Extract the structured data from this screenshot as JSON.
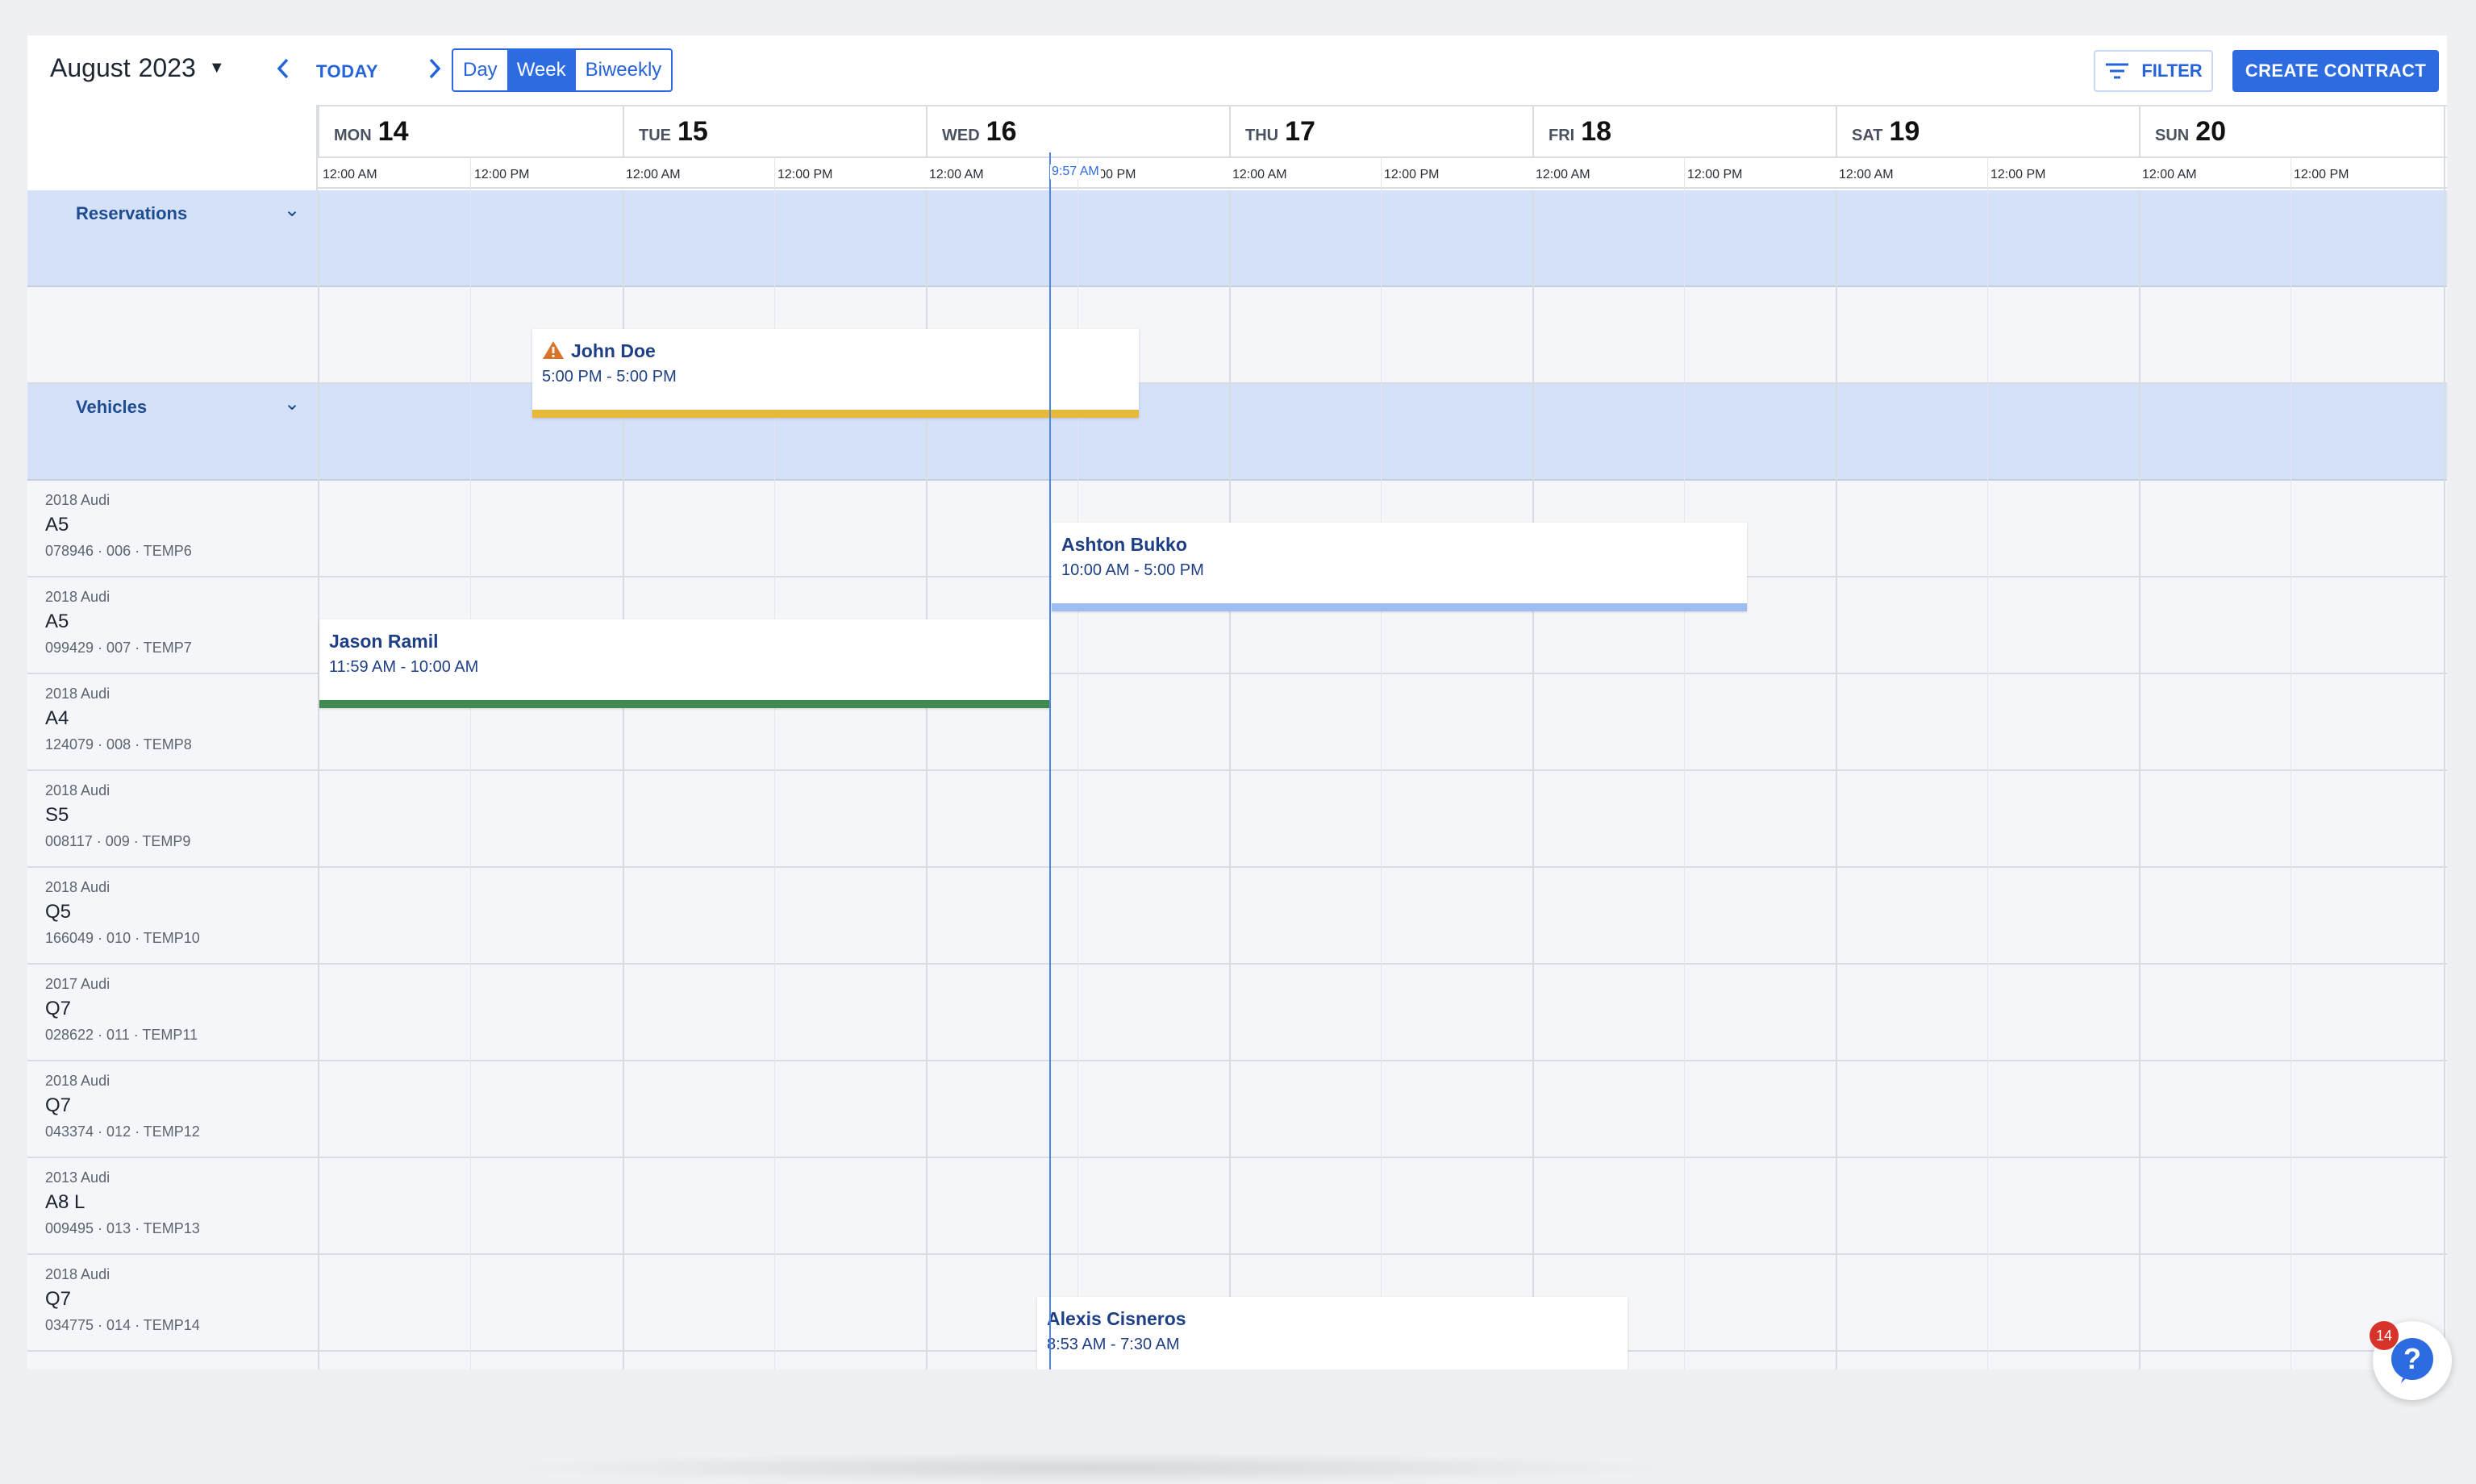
{
  "toolbar": {
    "month": "August",
    "year": "2023",
    "today_label": "TODAY",
    "views": [
      "Day",
      "Week",
      "Biweekly"
    ],
    "active_view": "Week",
    "filter_label": "FILTER",
    "create_label": "CREATE CONTRACT"
  },
  "days": [
    {
      "name": "MON",
      "date": "14"
    },
    {
      "name": "TUE",
      "date": "15"
    },
    {
      "name": "WED",
      "date": "16"
    },
    {
      "name": "THU",
      "date": "17"
    },
    {
      "name": "FRI",
      "date": "18"
    },
    {
      "name": "SAT",
      "date": "19"
    },
    {
      "name": "SUN",
      "date": "20"
    }
  ],
  "time_labels": [
    "12:00 AM",
    "12:00 PM"
  ],
  "now_label": "9:57 AM",
  "groups": {
    "reservations": "Reservations",
    "vehicles": "Vehicles"
  },
  "vehicles": [
    {
      "year": "2018 Audi",
      "model": "A5",
      "meta": "078946 · 006 · TEMP6"
    },
    {
      "year": "2018 Audi",
      "model": "A5",
      "meta": "099429 · 007 · TEMP7"
    },
    {
      "year": "2018 Audi",
      "model": "A4",
      "meta": "124079 · 008 · TEMP8"
    },
    {
      "year": "2018 Audi",
      "model": "S5",
      "meta": "008117 · 009 · TEMP9"
    },
    {
      "year": "2018 Audi",
      "model": "Q5",
      "meta": "166049 · 010 · TEMP10"
    },
    {
      "year": "2017 Audi",
      "model": "Q7",
      "meta": "028622 · 011 · TEMP11"
    },
    {
      "year": "2018 Audi",
      "model": "Q7",
      "meta": "043374 · 012 · TEMP12"
    },
    {
      "year": "2013 Audi",
      "model": "A8 L",
      "meta": "009495 · 013 · TEMP13"
    },
    {
      "year": "2018 Audi",
      "model": "Q7",
      "meta": "034775 · 014 · TEMP14"
    }
  ],
  "events": {
    "john": {
      "name": "John Doe",
      "time": "5:00 PM - 5:00 PM",
      "color": "#e8b83a"
    },
    "ashton": {
      "name": "Ashton Bukko",
      "time": "10:00 AM - 5:00 PM",
      "color": "#9dbdf3"
    },
    "jason": {
      "name": "Jason Ramil",
      "time": "11:59 AM - 10:00 AM",
      "color": "#3f8a4f"
    },
    "alexis": {
      "name": "Alexis Cisneros",
      "time": "8:53 AM - 7:30 AM",
      "color": "#2d6be0"
    }
  },
  "help": {
    "badge_count": "14"
  },
  "colors": {
    "accent": "#2d6be0",
    "group_bg": "#d4e1f8",
    "warning": "#d8742a"
  }
}
